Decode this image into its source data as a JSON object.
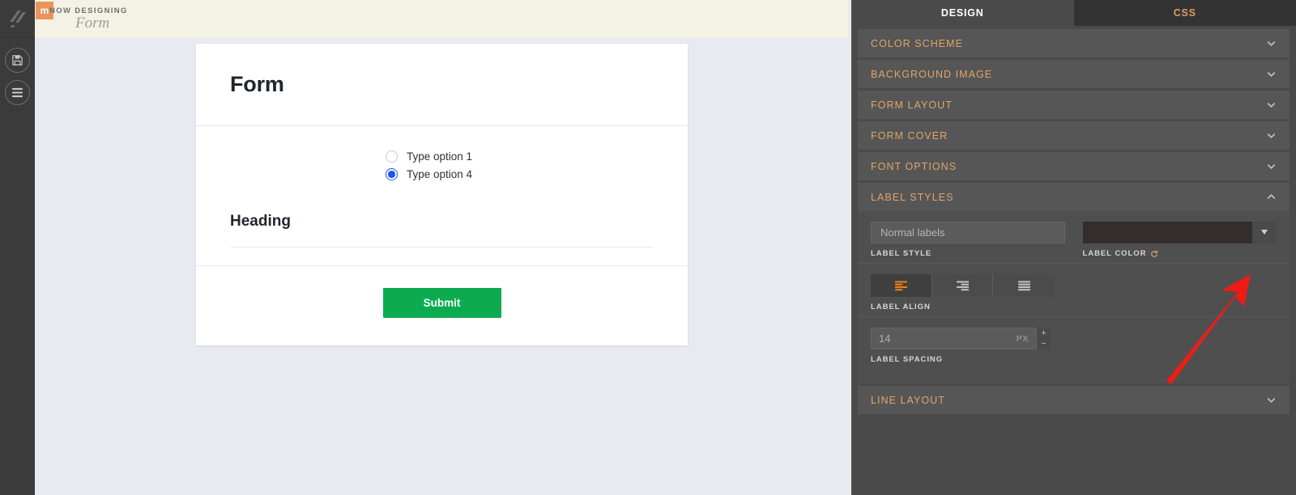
{
  "left_rail": {
    "logo_icon": "app-logo-icon",
    "buttons": [
      {
        "icon": "save-icon",
        "name": "save-button"
      },
      {
        "icon": "menu-icon",
        "name": "menu-button"
      }
    ]
  },
  "design_bar": {
    "badge": "m",
    "eyebrow": "NOW DESIGNING",
    "title": "Form"
  },
  "form_preview": {
    "title": "Form",
    "radio_options": [
      {
        "label": "Type option 1",
        "selected": false
      },
      {
        "label": "Type option 4",
        "selected": true
      }
    ],
    "heading": "Heading",
    "submit_label": "Submit",
    "submit_color": "#0dab4f",
    "radio_accent": "#1a56ec"
  },
  "panel": {
    "tabs": [
      {
        "label": "DESIGN",
        "active": true
      },
      {
        "label": "CSS",
        "active": false
      }
    ],
    "sections": [
      {
        "title": "COLOR SCHEME",
        "expanded": false
      },
      {
        "title": "BACKGROUND IMAGE",
        "expanded": false
      },
      {
        "title": "FORM LAYOUT",
        "expanded": false
      },
      {
        "title": "FORM COVER",
        "expanded": false
      },
      {
        "title": "FONT OPTIONS",
        "expanded": false
      },
      {
        "title": "LABEL STYLES",
        "expanded": true
      },
      {
        "title": "LINE LAYOUT",
        "expanded": false
      }
    ],
    "label_styles": {
      "label_style": {
        "value": "Normal labels",
        "caption": "LABEL STYLE"
      },
      "label_color": {
        "caption": "LABEL COLOR",
        "swatch_hex": "#332e2d",
        "reset_icon": "reset-icon",
        "dropdown_icon": "chevron-down-icon"
      },
      "label_align": {
        "caption": "LABEL ALIGN",
        "options": [
          {
            "icon": "align-left-icon",
            "active": true
          },
          {
            "icon": "align-right-icon",
            "active": false
          },
          {
            "icon": "align-justify-icon",
            "active": false
          }
        ],
        "active_color": "#ef7f1a"
      },
      "label_spacing": {
        "caption": "LABEL SPACING",
        "value": "14",
        "unit": "PX",
        "increment": "+",
        "decrement": "−"
      }
    },
    "accent_hex": "#e0a56a"
  },
  "annotation": {
    "arrow_color": "#ee1c16",
    "name": "red-pointer-arrow"
  }
}
